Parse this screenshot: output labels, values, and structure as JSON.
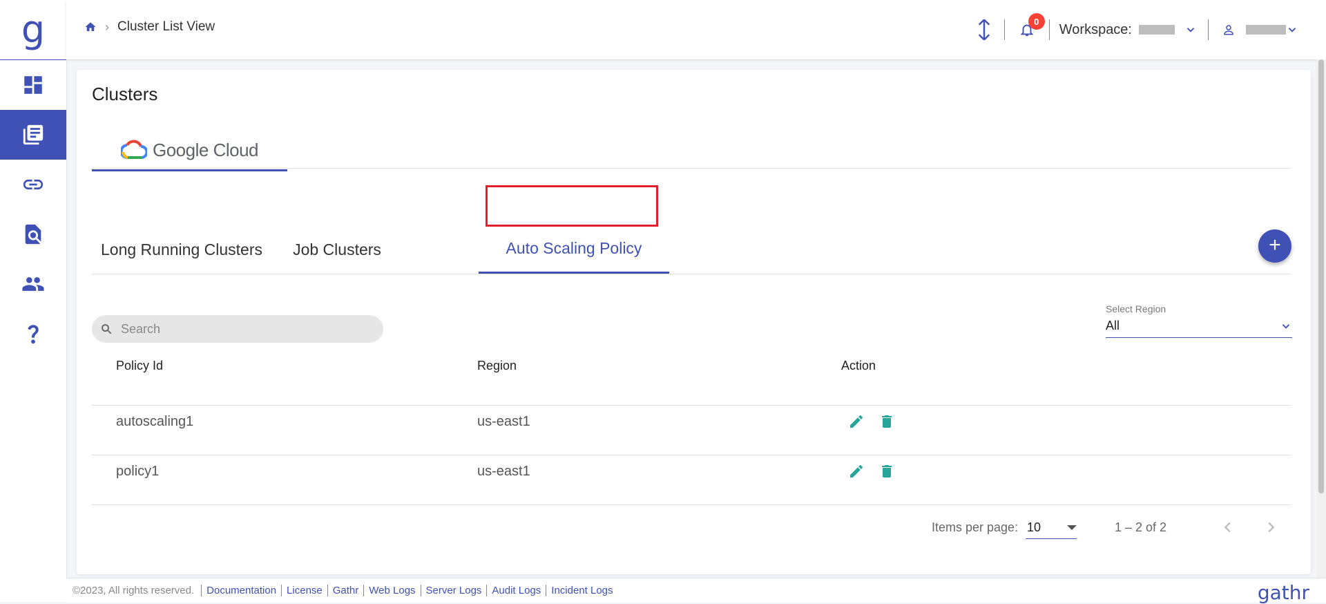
{
  "colors": {
    "accent": "#3f51b5",
    "action": "#26a69a",
    "alert": "#f44336",
    "highlight": "#e0202a"
  },
  "sidebar": {
    "logo": "g",
    "items": [
      {
        "icon": "dashboard-icon"
      },
      {
        "icon": "clusters-icon",
        "active": true
      },
      {
        "icon": "link-icon"
      },
      {
        "icon": "search-document-icon"
      },
      {
        "icon": "users-icon"
      },
      {
        "icon": "help-icon"
      }
    ]
  },
  "header": {
    "breadcrumb": {
      "home_icon": "home-icon",
      "current": "Cluster List View"
    },
    "notification_count": "0",
    "workspace_label": "Workspace:",
    "user_icon": "user-icon"
  },
  "page": {
    "title": "Clusters",
    "provider_tab": {
      "label_part1": "Google",
      "label_part2": " Cloud"
    },
    "tabs": [
      {
        "label": "Long Running Clusters",
        "active": false
      },
      {
        "label": "Job Clusters",
        "active": false
      },
      {
        "label": "Auto Scaling Policy",
        "active": true
      }
    ],
    "add_button": "+",
    "search": {
      "placeholder": "Search",
      "value": ""
    },
    "region_select": {
      "label": "Select Region",
      "value": "All"
    }
  },
  "table": {
    "columns": [
      "Policy Id",
      "Region",
      "Action"
    ],
    "rows": [
      {
        "policy_id": "autoscaling1",
        "region": "us-east1"
      },
      {
        "policy_id": "policy1",
        "region": "us-east1"
      }
    ]
  },
  "paginator": {
    "items_per_page_label": "Items per page:",
    "items_per_page_value": "10",
    "range": "1 – 2 of 2"
  },
  "footer": {
    "copyright": "©2023, All rights reserved.",
    "links": [
      "Documentation",
      "License",
      "Gathr",
      "Web Logs",
      "Server Logs",
      "Audit Logs",
      "Incident Logs"
    ],
    "brand": "gathr"
  }
}
